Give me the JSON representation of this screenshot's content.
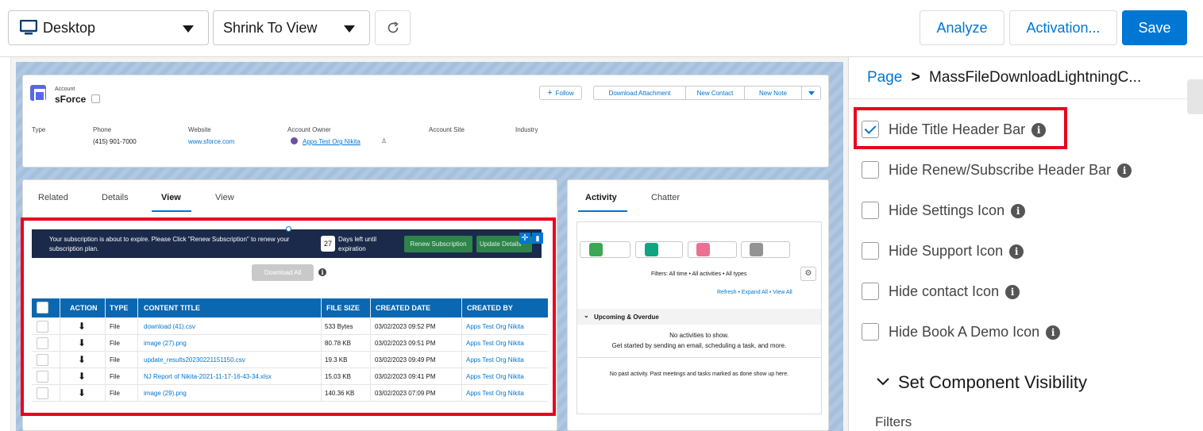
{
  "toolbar": {
    "device_label": "Desktop",
    "zoom_label": "Shrink To View",
    "analyze_label": "Analyze",
    "activation_label": "Activation...",
    "save_label": "Save"
  },
  "record": {
    "object_label": "Account",
    "name": "sForce",
    "actions": [
      "Follow",
      "Download Attachment",
      "New Contact",
      "New Note"
    ],
    "fields": [
      {
        "label": "Type",
        "value": ""
      },
      {
        "label": "Phone",
        "value": "(415) 901-7000"
      },
      {
        "label": "Website",
        "value": "www.sforce.com"
      },
      {
        "label": "Account Owner",
        "value": "Apps Test Org Nikita"
      },
      {
        "label": "Account Site",
        "value": ""
      },
      {
        "label": "Industry",
        "value": ""
      }
    ]
  },
  "tabs": [
    "Related",
    "Details",
    "View",
    "View"
  ],
  "banner": {
    "message": "Your subscription is about to expire. Please Click \"Renew Subscription\" to renew your subscription plan.",
    "days": "27",
    "days_label": "Days left until expiration",
    "renew_label": "Renew Subscription",
    "update_label": "Update Details"
  },
  "download_all_label": "Download All",
  "table": {
    "columns": [
      "ACTION",
      "TYPE",
      "CONTENT TITLE",
      "FILE SIZE",
      "CREATED DATE",
      "CREATED BY"
    ],
    "rows": [
      {
        "type": "File",
        "title": "download (41).csv",
        "size": "533 Bytes",
        "date": "03/02/2023 09:52 PM",
        "by": "Apps Test Org Nikita"
      },
      {
        "type": "File",
        "title": "image (27).png",
        "size": "80.78 KB",
        "date": "03/02/2023 09:51 PM",
        "by": "Apps Test Org Nikita"
      },
      {
        "type": "File",
        "title": "update_results20230221151150.csv",
        "size": "19.3 KB",
        "date": "03/02/2023 09:49 PM",
        "by": "Apps Test Org Nikita"
      },
      {
        "type": "File",
        "title": "NJ Report of Nikita-2021-11-17-16-43-34.xlsx",
        "size": "15.03 KB",
        "date": "03/02/2023 09:41 PM",
        "by": "Apps Test Org Nikita"
      },
      {
        "type": "File",
        "title": "image (29).png",
        "size": "140.36 KB",
        "date": "03/02/2023 07:09 PM",
        "by": "Apps Test Org Nikita"
      }
    ]
  },
  "activity": {
    "tabs": [
      "Activity",
      "Chatter"
    ],
    "filters_text": "Filters: All time • All activities • All types",
    "links": "Refresh • Expand All • View All",
    "upcoming_label": "Upcoming & Overdue",
    "no_activity": "No activities to show.",
    "get_started": "Get started by sending an email, scheduling a task, and more.",
    "past_activity": "No past activity. Past meetings and tasks marked as done show up here."
  },
  "panel": {
    "breadcrumb_root": "Page",
    "breadcrumb_current": "MassFileDownloadLightningC...",
    "options": [
      {
        "label": "Hide Title Header Bar",
        "checked": true
      },
      {
        "label": "Hide Renew/Subscribe Header Bar",
        "checked": false
      },
      {
        "label": "Hide Settings Icon",
        "checked": false
      },
      {
        "label": "Hide Support Icon",
        "checked": false
      },
      {
        "label": "Hide contact Icon",
        "checked": false
      },
      {
        "label": "Hide Book A Demo Icon",
        "checked": false
      }
    ],
    "visibility_label": "Set Component Visibility",
    "filters_label": "Filters"
  },
  "colors": {
    "brand": "#0176d3",
    "highlight": "#ea001e",
    "table_header": "#0a67b2"
  }
}
